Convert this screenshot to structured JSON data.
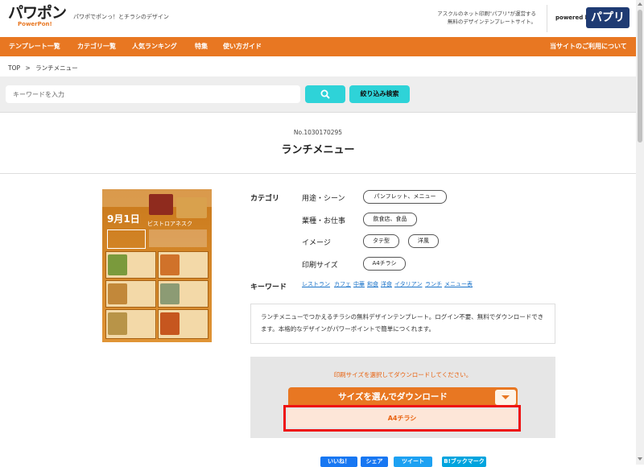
{
  "header": {
    "logo": "パワポン",
    "logo_sub": "PowerPon!",
    "tagline": "パワポでポンっ！とチラシのデザイン",
    "note_line1": "アスクルのネット印刷\"パプリ\"が運営する",
    "note_line2": "無料のデザインテンプレートサイト。",
    "powered_by": "powered by",
    "papuri_logo": "パプリ"
  },
  "nav": {
    "items": [
      "テンプレート一覧",
      "カテゴリ一覧",
      "人気ランキング",
      "特集",
      "使い方ガイド"
    ],
    "right": "当サイトのご利用について"
  },
  "breadcrumb": {
    "home": "TOP",
    "sep": ">",
    "current": "ランチメニュー"
  },
  "search": {
    "placeholder": "キーワードを入力",
    "search_icon": "search-icon",
    "filter_label": "絞り込み検索"
  },
  "item": {
    "number": "No.1030170295",
    "title": "ランチメニュー"
  },
  "category": {
    "section_label": "カテゴリ",
    "rows": [
      {
        "label": "用途・シーン",
        "tags": [
          "パンフレット、メニュー"
        ]
      },
      {
        "label": "業種・お仕事",
        "tags": [
          "飲食店、食品"
        ]
      },
      {
        "label": "イメージ",
        "tags": [
          "タテ型",
          "洋風"
        ]
      },
      {
        "label": "印刷サイズ",
        "tags": [
          "A4チラシ"
        ]
      }
    ]
  },
  "keywords": {
    "label": "キーワード",
    "items": [
      "レストラン",
      "カフェ",
      "中華",
      "和食",
      "洋食",
      "イタリアン",
      "ランチ",
      "メニュー表"
    ]
  },
  "description": "ランチメニューでつかえるチラシの無料デザインテンプレート。ログイン不要、無料でダウンロードできます。本格的なデザインがパワーポイントで簡単につくれます。",
  "download": {
    "message": "印刷サイズを選択してダウンロードしてください。",
    "button_label": "サイズを選んでダウンロード",
    "option": "A4チラシ"
  },
  "share": {
    "facebook": "いいね！",
    "share": "シェア",
    "tweet": "ツイート",
    "bookmark": "B!ブックマーク"
  },
  "thumbnail": {
    "date": "9月1日",
    "shop": "ビストロアネスク"
  },
  "colors": {
    "accent": "#e87722",
    "cyan": "#2ed3d8",
    "highlight": "#ee1111"
  }
}
